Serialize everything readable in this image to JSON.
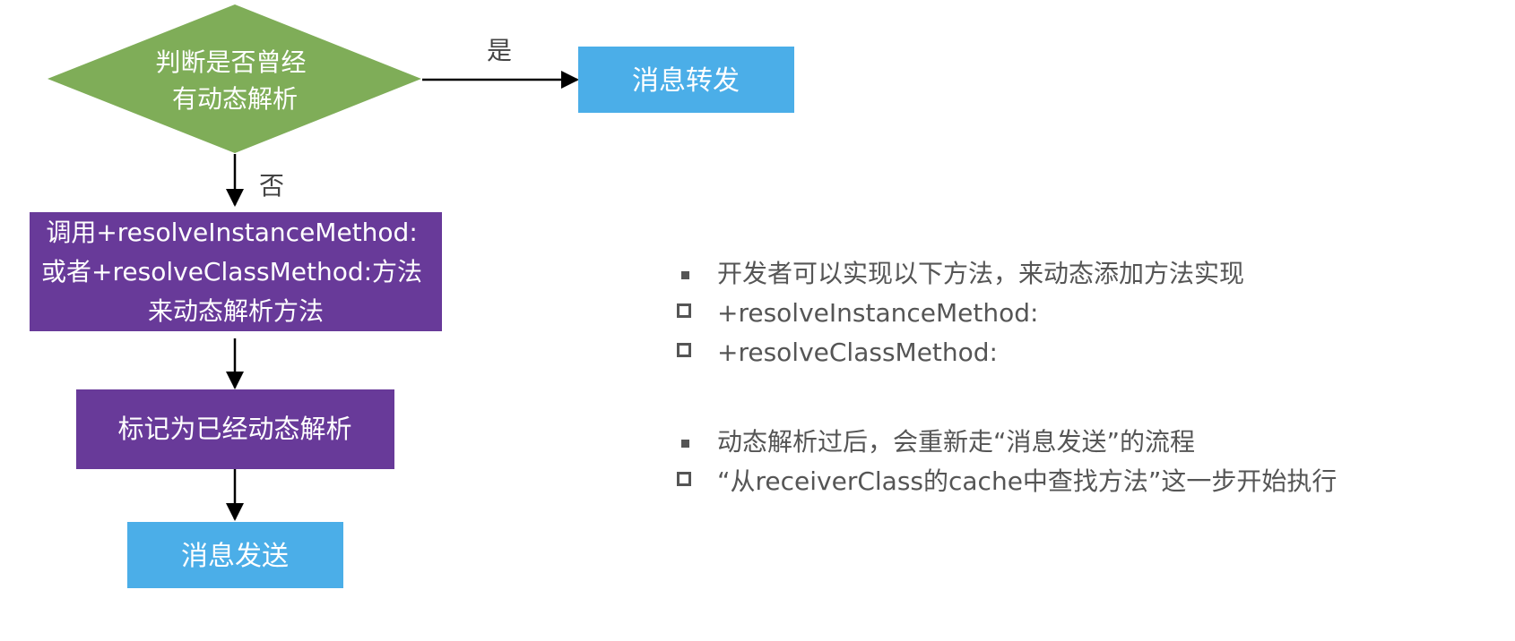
{
  "flowchart": {
    "decision": {
      "lines": [
        "判断是否曾经",
        "有动态解析"
      ],
      "fill": "#7FAD58"
    },
    "yes_label": "是",
    "no_label": "否",
    "forward_box": {
      "text": "消息转发",
      "fill": "#4BAEE8"
    },
    "resolve_box": {
      "lines": [
        "调用+resolveInstanceMethod:",
        "或者+resolveClassMethod:方法",
        "来动态解析方法"
      ],
      "fill": "#683A99"
    },
    "mark_box": {
      "text": "标记为已经动态解析",
      "fill": "#683A99"
    },
    "send_box": {
      "text": "消息发送",
      "fill": "#4BAEE8"
    }
  },
  "notes": {
    "group1": {
      "main": "开发者可以实现以下方法，来动态添加方法实现",
      "subs": [
        "+resolveInstanceMethod:",
        "+resolveClassMethod:"
      ]
    },
    "group2": {
      "main": "动态解析过后，会重新走“消息发送”的流程",
      "subs": [
        "“从receiverClass的cache中查找方法”这一步开始执行"
      ]
    }
  }
}
